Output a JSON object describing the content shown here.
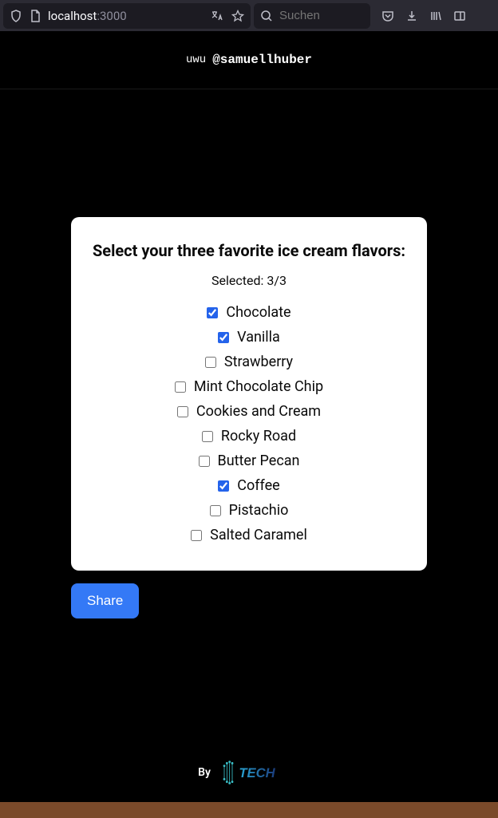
{
  "browser": {
    "url_host": "localhost",
    "url_port": ":3000",
    "search_placeholder": "Suchen"
  },
  "header": {
    "prefix": "uwu",
    "handle": "@samuellhuber"
  },
  "card": {
    "title": "Select your three favorite ice cream flavors:",
    "selected_label": "Selected: 3/3",
    "flavors": [
      {
        "label": "Chocolate",
        "checked": true
      },
      {
        "label": "Vanilla",
        "checked": true
      },
      {
        "label": "Strawberry",
        "checked": false
      },
      {
        "label": "Mint Chocolate Chip",
        "checked": false
      },
      {
        "label": "Cookies and Cream",
        "checked": false
      },
      {
        "label": "Rocky Road",
        "checked": false
      },
      {
        "label": "Butter Pecan",
        "checked": false
      },
      {
        "label": "Coffee",
        "checked": true
      },
      {
        "label": "Pistachio",
        "checked": false
      },
      {
        "label": "Salted Caramel",
        "checked": false
      }
    ]
  },
  "share_button_label": "Share",
  "footer": {
    "by_label": "By",
    "logo_text": "TECH"
  }
}
